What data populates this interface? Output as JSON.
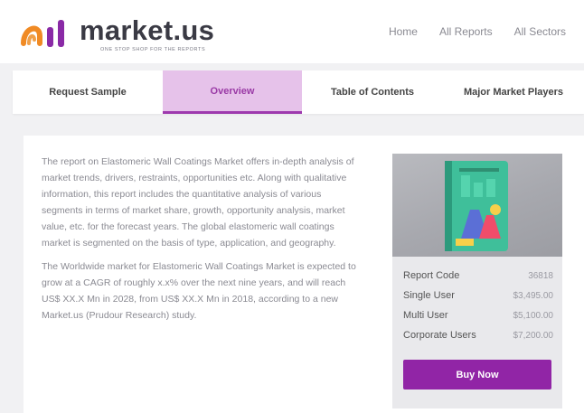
{
  "brand": {
    "name": "market.us",
    "tagline": "ONE STOP SHOP FOR THE REPORTS",
    "colors": {
      "primary": "#9125a6",
      "logo_orange": "#f08a24",
      "logo_purple": "#8a2aa6",
      "active_tab_bg": "#e6c2ea"
    }
  },
  "top_nav": [
    "Home",
    "All Reports",
    "All Sectors"
  ],
  "tabs": [
    {
      "label": "Request Sample",
      "active": false
    },
    {
      "label": "Overview",
      "active": true
    },
    {
      "label": "Table of Contents",
      "active": false
    },
    {
      "label": "Major Market Players",
      "active": false
    }
  ],
  "overview": {
    "paragraph1": "The report on Elastomeric Wall Coatings Market offers in-depth analysis of market trends, drivers, restraints, opportunities etc. Along with qualitative information, this report includes the quantitative analysis of various segments in terms of market share, growth, opportunity analysis, market value, etc. for the forecast years. The global elastomeric wall coatings market is segmented on the basis of type, application, and geography.",
    "paragraph2": "The Worldwide market for Elastomeric Wall Coatings Market is expected to grow at a CAGR of roughly x.x% over the next nine years, and will reach US$ XX.X Mn in 2028, from US$ XX.X Mn in 2018, according to a new Market.us (Prudour Research) study."
  },
  "report_panel": {
    "report_code_label": "Report Code",
    "report_code": "36818",
    "prices": [
      {
        "label": "Single User",
        "value": "$3,495.00"
      },
      {
        "label": "Multi User",
        "value": "$5,100.00"
      },
      {
        "label": "Corporate Users",
        "value": "$7,200.00"
      }
    ],
    "buy_label": "Buy Now",
    "cover_icon": "report-book-icon"
  }
}
